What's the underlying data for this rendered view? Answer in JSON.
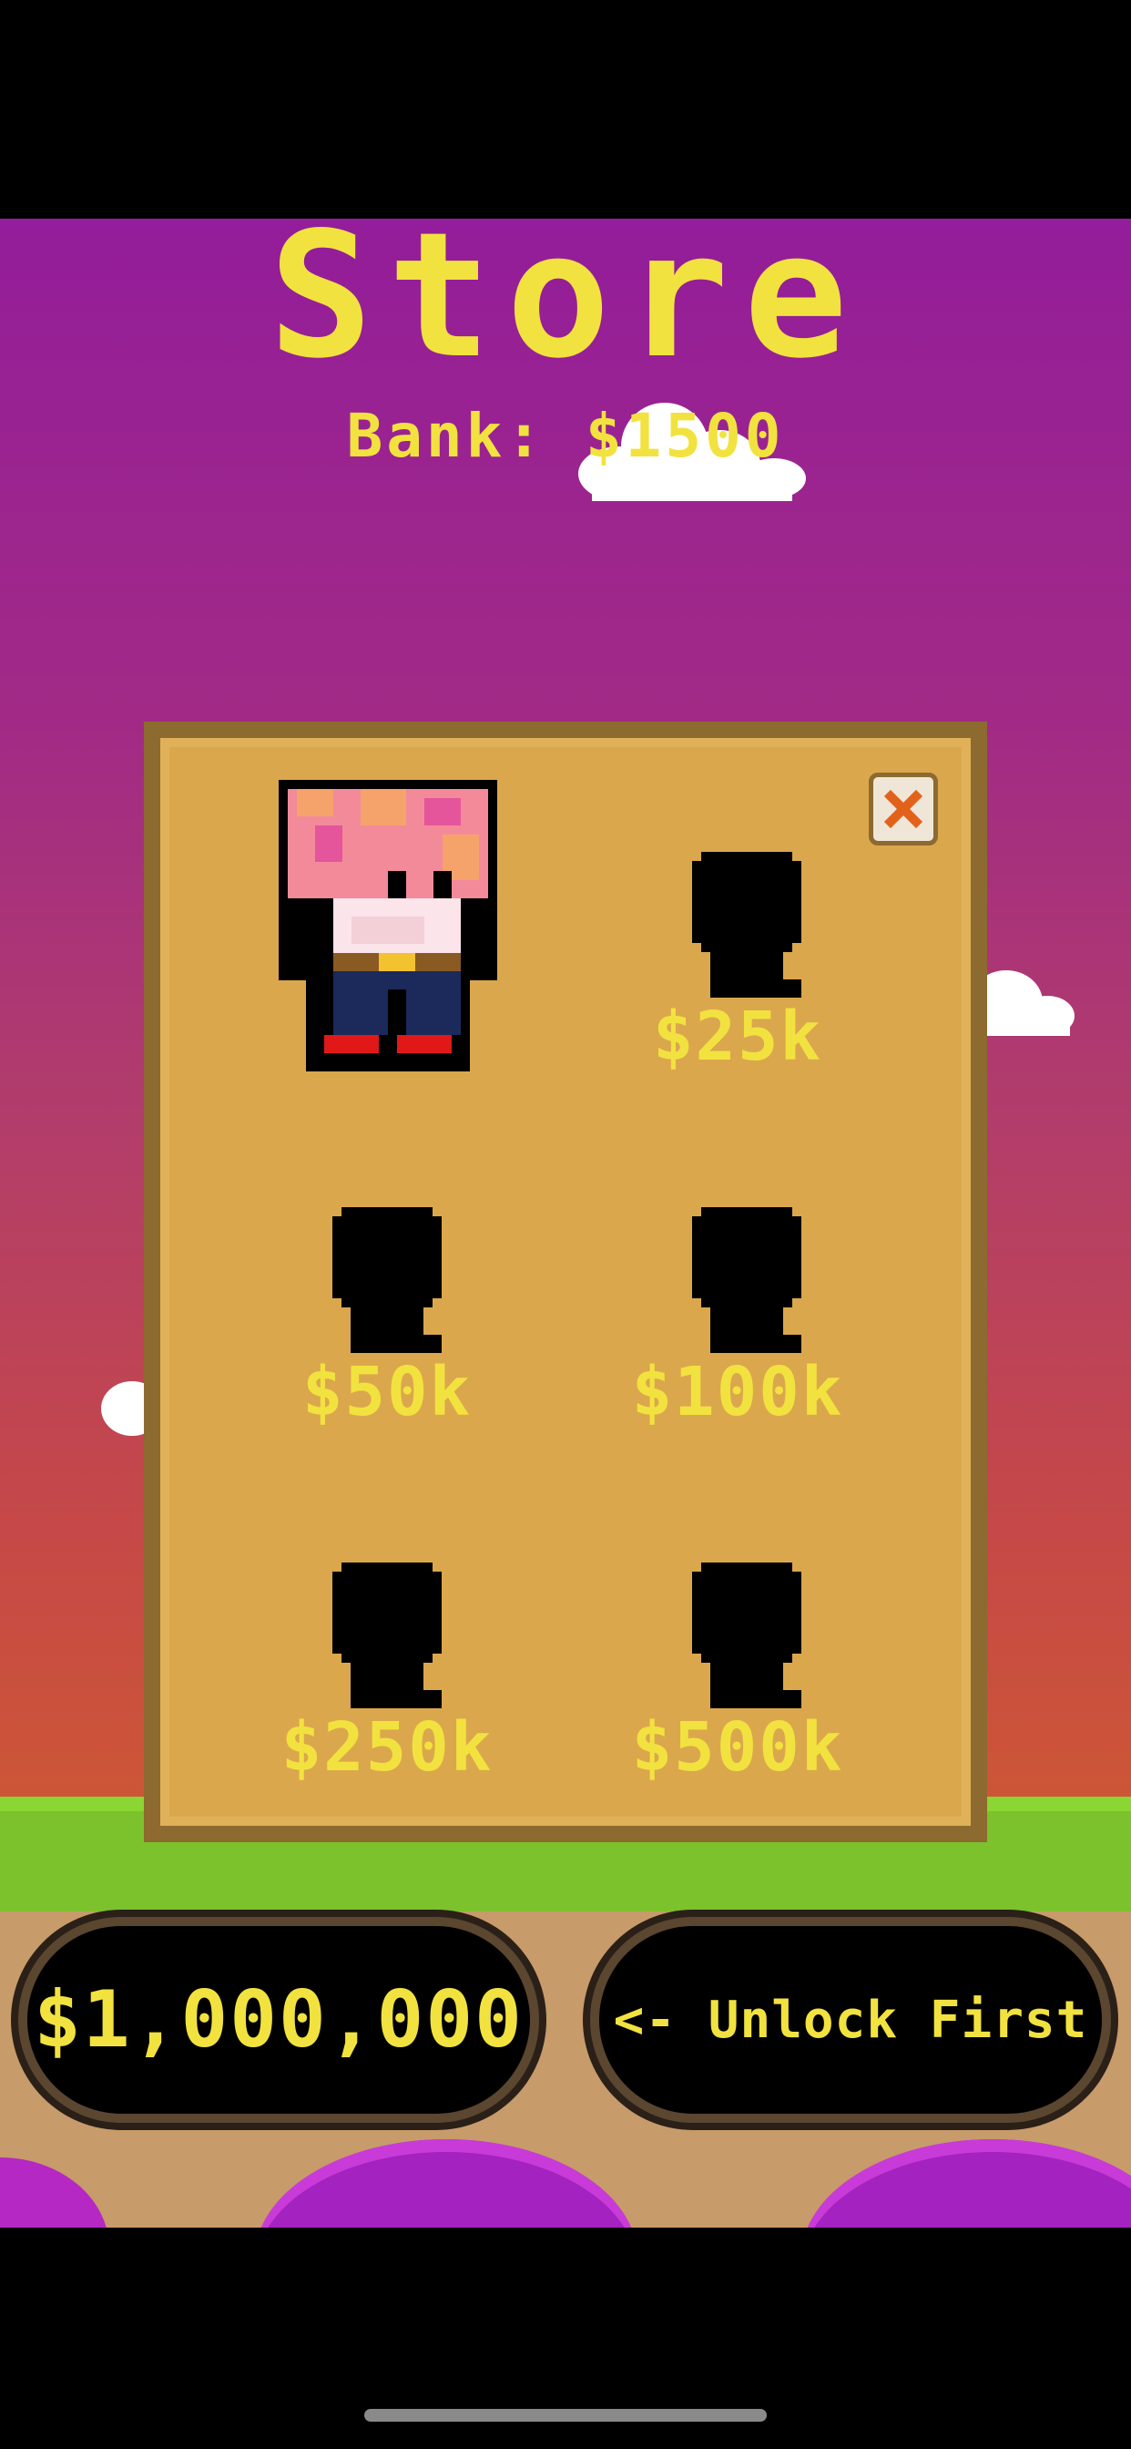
{
  "store": {
    "title": "Store",
    "bank_label": "Bank: $1500"
  },
  "close_button": {
    "icon": "close-icon",
    "color": "#e2621b"
  },
  "characters": [
    {
      "state": "unlocked",
      "price": ""
    },
    {
      "state": "locked",
      "price": "$25k"
    },
    {
      "state": "locked",
      "price": "$50k"
    },
    {
      "state": "locked",
      "price": "$100k"
    },
    {
      "state": "locked",
      "price": "$250k"
    },
    {
      "state": "locked",
      "price": "$500k"
    }
  ],
  "bottom_buttons": {
    "buy_label": "$1,000,000",
    "unlock_label": "<- Unlock First"
  },
  "colors": {
    "text": "#f2e23f",
    "panel": "#dba74d",
    "panel_border": "#8c6a30",
    "sky_top": "#931d9a",
    "sky_bottom": "#d35e22",
    "grass": "#7cc22c"
  }
}
